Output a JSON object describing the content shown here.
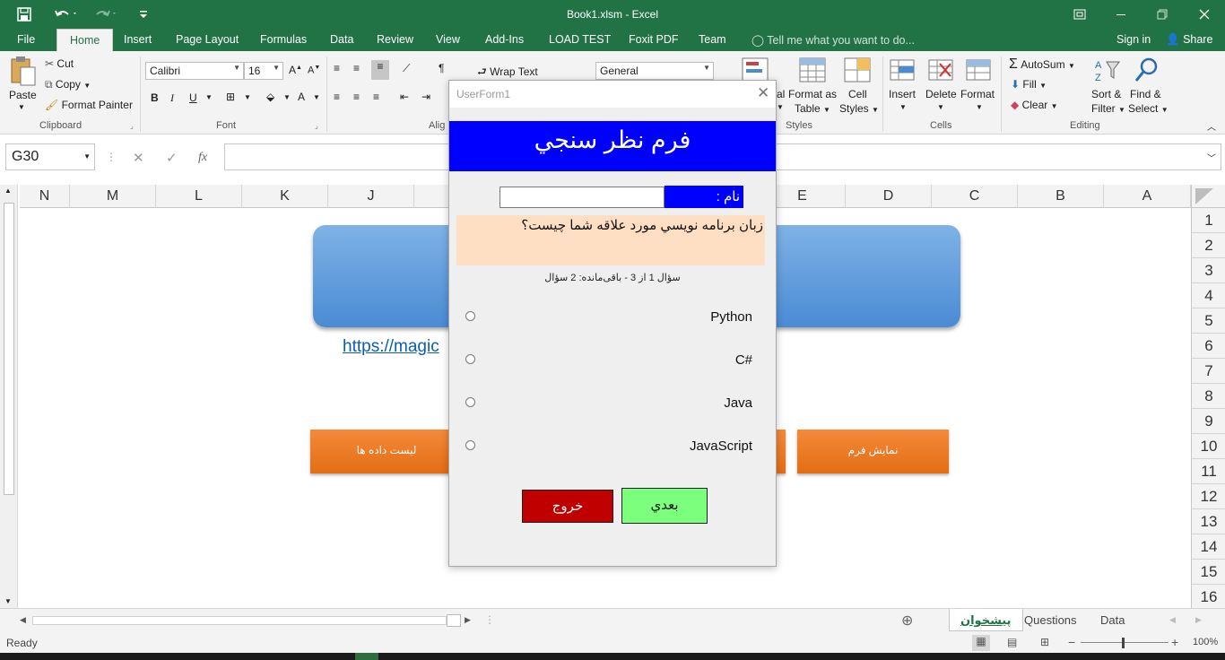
{
  "window": {
    "title": "Book1.xlsm - Excel"
  },
  "ribbon_tabs": [
    "File",
    "Home",
    "Insert",
    "Page Layout",
    "Formulas",
    "Data",
    "Review",
    "View",
    "Add-Ins",
    "LOAD TEST",
    "Foxit PDF",
    "Team"
  ],
  "tell_me": "Tell me what you want to do...",
  "account": {
    "signin": "Sign in",
    "share": "Share"
  },
  "clipboard": {
    "paste": "Paste",
    "cut": "Cut",
    "copy": "Copy",
    "format_painter": "Format Painter",
    "group": "Clipboard"
  },
  "font": {
    "name": "Calibri",
    "size": "16",
    "bold": "B",
    "italic": "I",
    "underline": "U",
    "group": "Font"
  },
  "alignment": {
    "wrap_text": "Wrap Text",
    "group_partial": "Alig"
  },
  "number": {
    "format": "General"
  },
  "styles": {
    "format_as_table": [
      "Format as",
      "Table"
    ],
    "cell_styles": [
      "Cell",
      "Styles"
    ],
    "group": "Styles",
    "cond_partial": "al"
  },
  "cells": {
    "insert": "Insert",
    "delete": "Delete",
    "format": "Format",
    "group": "Cells"
  },
  "editing": {
    "autosum": "AutoSum",
    "fill": "Fill",
    "clear": "Clear",
    "sort_filter": [
      "Sort &",
      "Filter"
    ],
    "find_select": [
      "Find &",
      "Select"
    ],
    "group": "Editing"
  },
  "namebox": "G30",
  "formula_icons": {
    "cancel": "✕",
    "enter": "✓",
    "fx": "fx"
  },
  "columns": [
    "N",
    "M",
    "L",
    "K",
    "J",
    "E",
    "D",
    "C",
    "B",
    "A"
  ],
  "rows": [
    "1",
    "2",
    "3",
    "4",
    "5",
    "6",
    "7",
    "8",
    "9",
    "10",
    "11",
    "12",
    "13",
    "14",
    "15",
    "16"
  ],
  "sheet": {
    "link": "https://magic",
    "btn_list": "لیست داده ها",
    "btn_show_form": "نمایش فرم"
  },
  "sheet_tabs": [
    "پیشخوان",
    "Questions",
    "Data"
  ],
  "status": {
    "ready": "Ready",
    "zoom": "100%"
  },
  "userform": {
    "title": "UserForm1",
    "header": "فرم نظر سنجي",
    "name_label": "نام :",
    "name_value": "",
    "question": "زبان برنامه نویسي مورد علاقه شما چیست؟",
    "progress": "سؤال 1 از 3 - باقی‌مانده: 2 سؤال",
    "options": [
      "Python",
      "C#",
      "Java",
      "JavaScript"
    ],
    "exit_label": "خروج",
    "next_label": "بعدي"
  },
  "colors": {
    "excel_green": "#217346",
    "form_header": "#0000ff",
    "exit_button": "#c00000",
    "next_button": "#7cff7c",
    "question_bg": "#ffdfc4"
  }
}
